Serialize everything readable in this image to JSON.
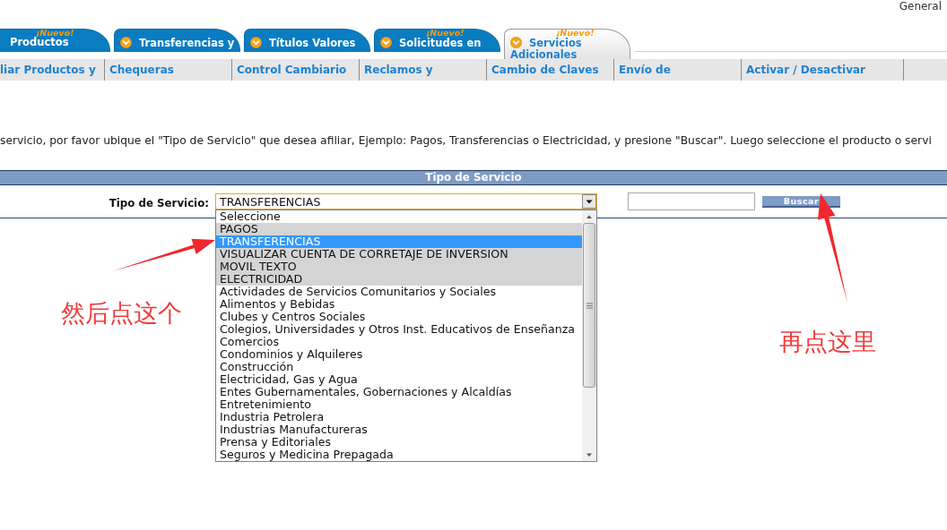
{
  "header": {
    "link": "General"
  },
  "tabs": [
    {
      "label": "Productos",
      "badge": "¡Nuevo!",
      "icon": false,
      "selected": false
    },
    {
      "label": "Transferencias y",
      "icon": true,
      "selected": false
    },
    {
      "label": "Títulos Valores",
      "icon": true,
      "selected": false
    },
    {
      "label": "Solicitudes en",
      "badge": "¡Nuevo!",
      "icon": true,
      "selected": false
    },
    {
      "label": "Servicios Adicionales",
      "badge": "¡Nuevo!",
      "icon": true,
      "selected": true
    }
  ],
  "submenu": [
    {
      "label": "liar Productos y"
    },
    {
      "label": "Chequeras"
    },
    {
      "label": "Control Cambiario"
    },
    {
      "label": "Reclamos y"
    },
    {
      "label": "Cambio de Claves"
    },
    {
      "label": "Envío de"
    },
    {
      "label": "Activar / Desactivar"
    }
  ],
  "instructions": "servicio, por favor ubique el \"Tipo de Servicio\" que desea afiliar, Ejemplo: Pagos, Transferencias o Electricidad, y presione \"Buscar\". Luego seleccione el producto o servi",
  "form": {
    "title": "Tipo de Servicio",
    "label": "Tipo de Servicio:",
    "select": {
      "value": "TRANSFERENCIAS",
      "expanded": true,
      "options": [
        {
          "label": "Seleccione",
          "selected": false,
          "highlighted": false
        },
        {
          "label": "PAGOS",
          "selected": false,
          "highlighted": true
        },
        {
          "label": "TRANSFERENCIAS",
          "selected": true,
          "highlighted": true
        },
        {
          "label": "VISUALIZAR CUENTA DE CORRETAJE DE INVERSION",
          "selected": false,
          "highlighted": true
        },
        {
          "label": "MOVIL TEXTO",
          "selected": false,
          "highlighted": true
        },
        {
          "label": "ELECTRICIDAD",
          "selected": false,
          "highlighted": true
        },
        {
          "label": "Actividades de Servicios Comunitarios y Sociales",
          "selected": false,
          "highlighted": false
        },
        {
          "label": "Alimentos y Bebidas",
          "selected": false,
          "highlighted": false
        },
        {
          "label": "Clubes y Centros Sociales",
          "selected": false,
          "highlighted": false
        },
        {
          "label": "Colegios, Universidades y Otros Inst. Educativos de Enseñanza",
          "selected": false,
          "highlighted": false
        },
        {
          "label": "Comercios",
          "selected": false,
          "highlighted": false
        },
        {
          "label": "Condominios y Alquileres",
          "selected": false,
          "highlighted": false
        },
        {
          "label": "Construcción",
          "selected": false,
          "highlighted": false
        },
        {
          "label": "Electricidad, Gas y Agua",
          "selected": false,
          "highlighted": false
        },
        {
          "label": "Entes Gubernamentales, Gobernaciones y Alcaldías",
          "selected": false,
          "highlighted": false
        },
        {
          "label": "Entretenimiento",
          "selected": false,
          "highlighted": false
        },
        {
          "label": "Industria Petrolera",
          "selected": false,
          "highlighted": false
        },
        {
          "label": "Industrias Manufactureras",
          "selected": false,
          "highlighted": false
        },
        {
          "label": "Prensa y Editoriales",
          "selected": false,
          "highlighted": false
        },
        {
          "label": "Seguros y Medicina Prepagada",
          "selected": false,
          "highlighted": false
        }
      ]
    },
    "button": "Buscar"
  },
  "annotations": [
    {
      "text": "然后点这个"
    },
    {
      "text": "再点这里"
    }
  ]
}
